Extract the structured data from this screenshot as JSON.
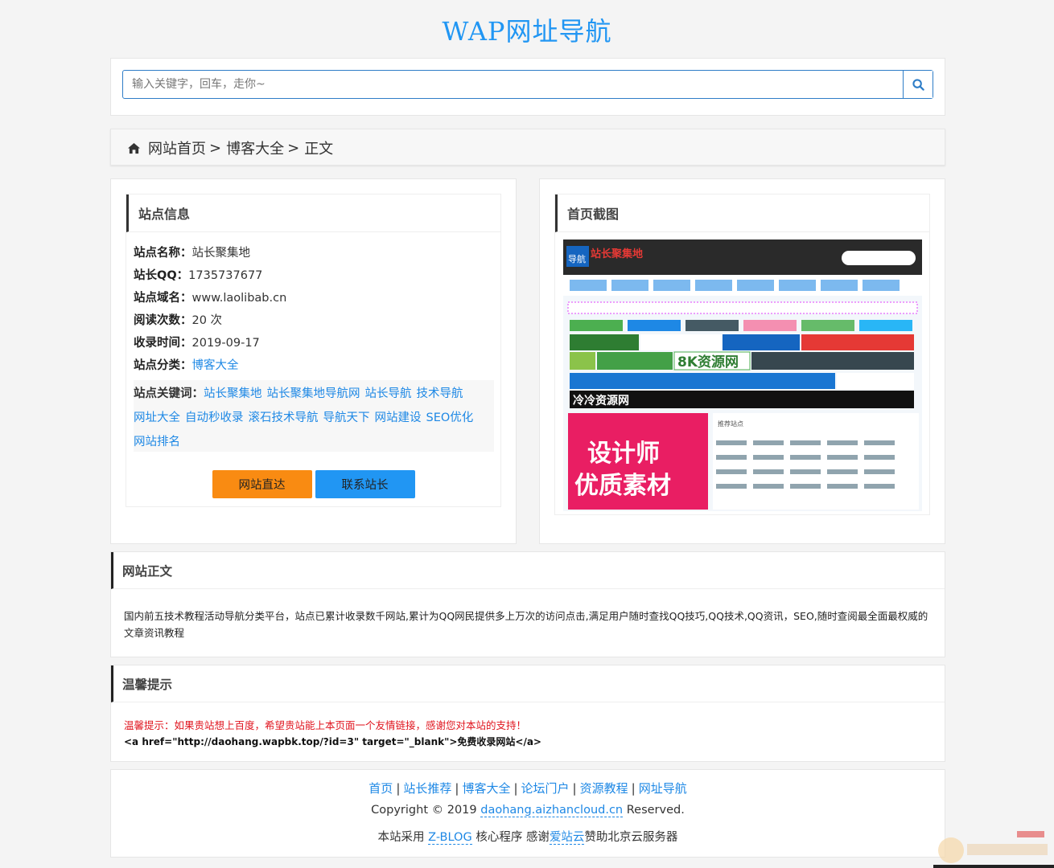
{
  "header": {
    "title": "WAP网址导航"
  },
  "search": {
    "placeholder": "输入关键字，回车，走你~",
    "icon": "search-icon"
  },
  "breadcrumb": {
    "icon": "home-icon",
    "items": [
      "网站首页",
      "博客大全",
      "正文"
    ],
    "separator": ">"
  },
  "site_info": {
    "heading": "站点信息",
    "rows": [
      {
        "label": "站点名称：",
        "value": "站长聚集地"
      },
      {
        "label": "站长QQ：",
        "value": "1735737677"
      },
      {
        "label": "站点域名：",
        "value": "www.laolibab.cn"
      },
      {
        "label": "阅读次数：",
        "value": "20 次"
      },
      {
        "label": "收录时间：",
        "value": "2019-09-17"
      },
      {
        "label": "站点分类：",
        "value": "博客大全"
      }
    ],
    "keywords_label": "站点关键词：",
    "keywords": [
      "站长聚集地",
      "站长聚集地导航网",
      "站长导航",
      "技术导航",
      "网址大全",
      "自动秒收录",
      "滚石技术导航",
      "导航天下",
      "网站建设",
      "SEO优化",
      "网站排名"
    ],
    "buttons": {
      "visit": "网站直达",
      "contact": "联系站长"
    },
    "colors": {
      "visit": "#f98b12",
      "contact": "#2196f3"
    }
  },
  "screenshot": {
    "heading": "首页截图",
    "thumb": {
      "logo_text": "站长聚集地",
      "logo_prefix": "导航",
      "tagline": "设计师",
      "tagline2": "优质素材",
      "banner_text": "8K资源网",
      "banner2": "冷冷资源网",
      "recommend_label": "推荐站点"
    }
  },
  "article": {
    "heading": "网站正文",
    "text": "国内前五技术教程活动导航分类平台，站点已累计收录数千网站,累计为QQ网民提供多上万次的访问点击,满足用户随时查找QQ技巧,QQ技术,QQ资讯，SEO,随时查阅最全面最权威的文章资讯教程"
  },
  "tip": {
    "heading": "温馨提示",
    "red_text": "温馨提示：如果贵站想上百度，希望贵站能上本页面一个友情链接，感谢您对本站的支持！",
    "code_text": "<a href=\"http://daohang.wapbk.top/?id=3\" target=\"_blank\">免费收录网站</a>"
  },
  "footer": {
    "links": [
      "首页",
      "站长推荐",
      "博客大全",
      "论坛门户",
      "资源教程",
      "网址导航"
    ],
    "copy_prefix": "Copyright © 2019",
    "copy_link": "daohang.aizhancloud.cn",
    "copy_suffix": "Reserved.",
    "power_prefix": "本站采用",
    "power_link": "Z-BLOG",
    "power_mid": "核心程序 感谢",
    "power_link2": "爱站云",
    "power_suffix": "赞助北京云服务器"
  }
}
